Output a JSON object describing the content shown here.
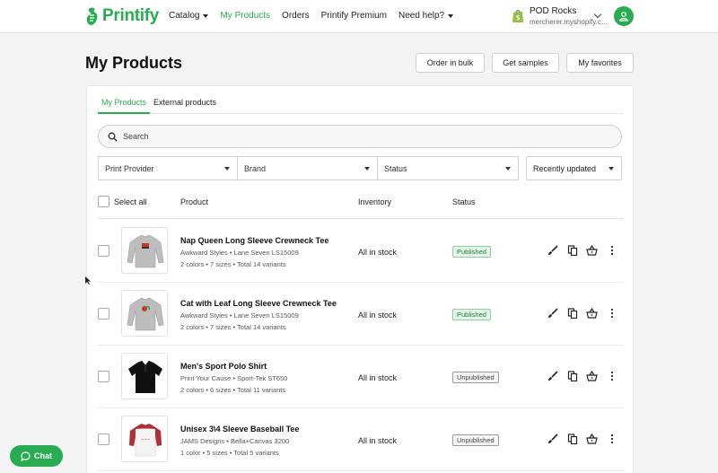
{
  "brand": {
    "name": "Printify",
    "color": "#29ab51"
  },
  "nav": {
    "items": [
      {
        "label": "Catalog",
        "dropdown": true,
        "active": false
      },
      {
        "label": "My Products",
        "dropdown": false,
        "active": true
      },
      {
        "label": "Orders",
        "dropdown": false,
        "active": false
      },
      {
        "label": "Printify Premium",
        "dropdown": false,
        "active": false
      },
      {
        "label": "Need help?",
        "dropdown": true,
        "active": false
      }
    ]
  },
  "store": {
    "name": "POD Rocks",
    "url": "mercherer.myshopify.c..."
  },
  "page": {
    "title": "My Products",
    "buttons": {
      "bulk": "Order in bulk",
      "samples": "Get samples",
      "favorites": "My favorites"
    }
  },
  "tabs": [
    "My Products",
    "External products"
  ],
  "search": {
    "placeholder": "Search"
  },
  "filters": {
    "provider": "Print Provider",
    "brand": "Brand",
    "status": "Status",
    "sort": "Recently updated"
  },
  "table": {
    "select_all": "Select all",
    "columns": {
      "product": "Product",
      "inventory": "Inventory",
      "status": "Status"
    },
    "rows": [
      {
        "name": "Nap Queen Long Sleeve Crewneck Tee",
        "provider": "Awkward Styles • Lane Seven LS15009",
        "variants": "2 colors • 7 sizes • Total 14 variants",
        "inventory": "All in stock",
        "status": "Published"
      },
      {
        "name": "Cat with Leaf Long Sleeve Crewneck Tee",
        "provider": "Awkward Styles • Lane Seven LS15009",
        "variants": "2 colors • 7 sizes • Total 14 variants",
        "inventory": "All in stock",
        "status": "Published"
      },
      {
        "name": "Men's Sport Polo Shirt",
        "provider": "Print Your Cause • Sport-Tek ST650",
        "variants": "2 colors • 6 sizes • Total 11 variants",
        "inventory": "All in stock",
        "status": "Unpublished"
      },
      {
        "name": "Unisex 3\\4 Sleeve Baseball Tee",
        "provider": "JAMS Designs • Bella+Canvas 3200",
        "variants": "1 color • 5 sizes • Total 5 variants",
        "inventory": "All in stock",
        "status": "Unpublished"
      }
    ]
  },
  "chat": {
    "label": "Chat"
  }
}
